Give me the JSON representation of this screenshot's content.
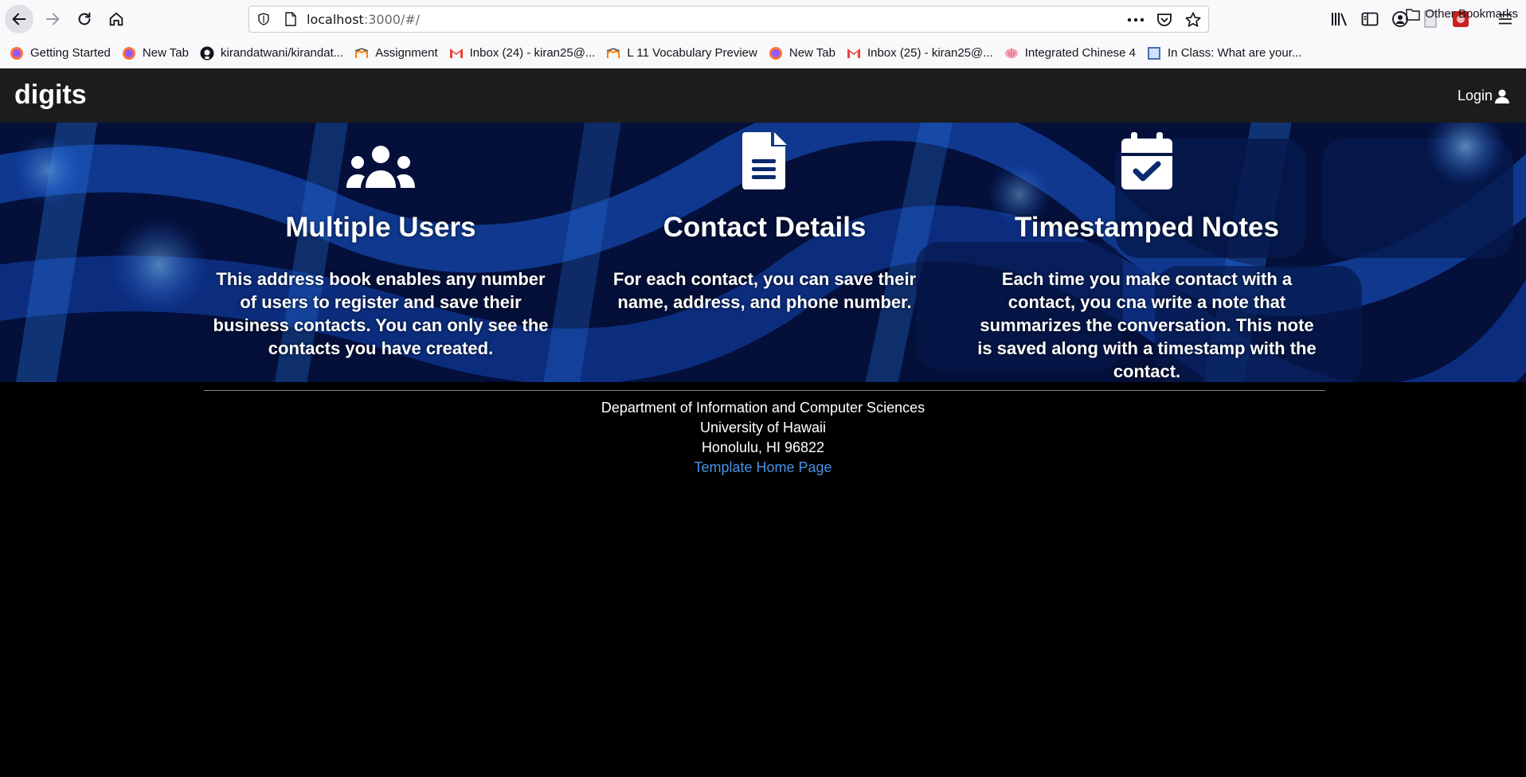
{
  "browser": {
    "url_host": "localhost",
    "url_rest": ":3000/#/",
    "bookmarks": [
      {
        "label": "Getting Started",
        "icon": "firefox-icon"
      },
      {
        "label": "New Tab",
        "icon": "firefox-icon"
      },
      {
        "label": "kirandatwani/kirandat...",
        "icon": "github-icon"
      },
      {
        "label": "Assignment",
        "icon": "moodle-icon"
      },
      {
        "label": "Inbox (24) - kiran25@...",
        "icon": "gmail-icon"
      },
      {
        "label": "L 11 Vocabulary Preview",
        "icon": "moodle-icon"
      },
      {
        "label": "New Tab",
        "icon": "firefox-icon"
      },
      {
        "label": "Inbox (25) - kiran25@...",
        "icon": "gmail-icon"
      },
      {
        "label": "Integrated Chinese 4",
        "icon": "brain-icon"
      },
      {
        "label": "In Class: What are your...",
        "icon": "page-icon"
      }
    ],
    "other_bookmarks": "Other Bookmarks"
  },
  "navbar": {
    "brand": "digits",
    "login": "Login"
  },
  "features": [
    {
      "icon": "users-icon",
      "title": "Multiple Users",
      "text": "This address book enables any number of users to register and save their business contacts. You can only see the contacts you have created."
    },
    {
      "icon": "file-text-icon",
      "title": "Contact Details",
      "text": "For each contact, you can save their name, address, and phone number."
    },
    {
      "icon": "calendar-check-icon",
      "title": "Timestamped Notes",
      "text": "Each time you make contact with a contact, you cna write a note that summarizes the conversation. This note is saved along with a timestamp with the contact."
    }
  ],
  "footer": {
    "line1": "Department of Information and Computer Sciences",
    "line2": "University of Hawaii",
    "line3": "Honolulu, HI 96822",
    "link": "Template Home Page"
  }
}
